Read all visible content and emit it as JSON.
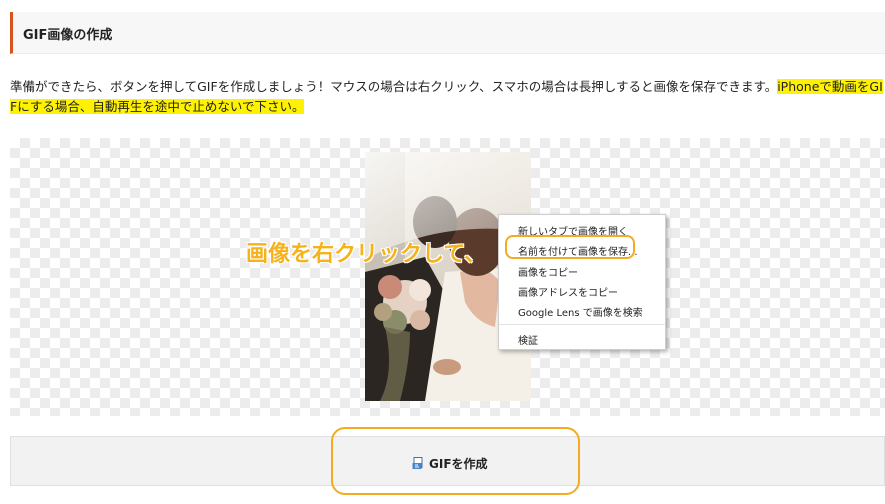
{
  "section": {
    "title": "GIF画像の作成"
  },
  "description": {
    "text": "準備ができたら、ボタンを押してGIFを作成しましょう！マウスの場合は右クリック、スマホの場合は長押しすると画像を保存できます。",
    "highlight": "iPhoneで動画をGIFにする場合、自動再生を途中で止めないで下さい。"
  },
  "overlay": {
    "text": "画像を右クリックして、"
  },
  "context_menu": {
    "items": [
      "新しいタブで画像を開く",
      "名前を付けて画像を保存...",
      "画像をコピー",
      "画像アドレスをコピー",
      "Google Lens で画像を検索",
      "検証"
    ],
    "highlighted_item": "名前を付けて画像を保存..."
  },
  "button": {
    "label": "GIFを作成",
    "icon": "gif-file-icon"
  },
  "colors": {
    "accent_orange": "#f2ab22",
    "header_bar": "#d9531e",
    "highlight_yellow": "#fff200"
  }
}
